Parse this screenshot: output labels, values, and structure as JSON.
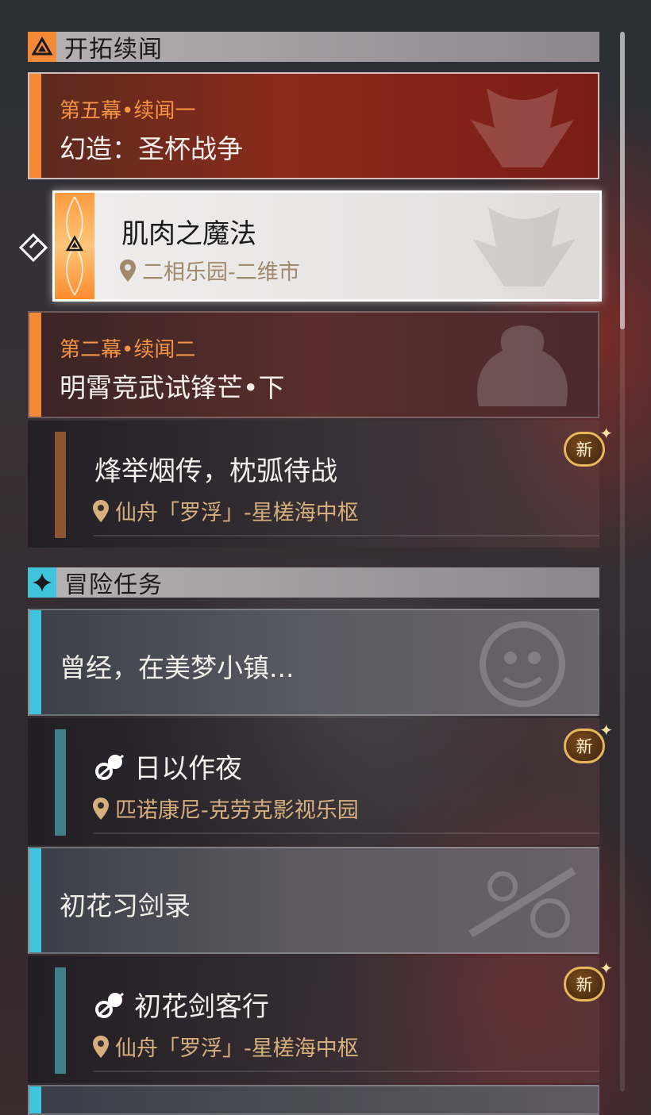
{
  "sections": {
    "trailblaze": {
      "title": "开拓续闻"
    },
    "adventure": {
      "title": "冒险任务"
    }
  },
  "chapters": {
    "c1": {
      "sub": "第五幕•续闻一",
      "title": "幻造：圣杯战争"
    },
    "c2": {
      "sub": "第二幕•续闻二",
      "title": "明霄竞武试锋芒•下"
    },
    "c3": {
      "title": "曾经，在美梦小镇..."
    },
    "c4": {
      "title": "初花习剑录"
    }
  },
  "quests": {
    "selected": {
      "title": "肌肉之魔法",
      "location": "二相乐园-二维市"
    },
    "q1": {
      "title": "烽举烟传，枕弧待战",
      "location": "仙舟「罗浮」-星槎海中枢",
      "badge": "新"
    },
    "q2": {
      "title": "日以作夜",
      "location": "匹诺康尼-克劳克影视乐园",
      "badge": "新"
    },
    "q3": {
      "title": "初花剑客行",
      "location": "仙舟「罗浮」-星槎海中枢",
      "badge": "新"
    }
  },
  "icons": {
    "trailblaze_section": "triangle-emblem-icon",
    "adventure_section": "four-point-star-icon",
    "location": "map-pin-icon",
    "quest_type": "adventure-quest-icon",
    "selector": "diamond-arrow-icon"
  },
  "colors": {
    "trailblaze_accent": "#f58a36",
    "adventure_accent": "#3fc4dc",
    "quest_bar_brown": "#8a5530",
    "quest_bar_teal": "#3f7f8a",
    "location_text": "#d6b07c",
    "badge_gold": "#e8b75a"
  },
  "scrollbar": {
    "position": 0,
    "visible_fraction": 0.28
  }
}
